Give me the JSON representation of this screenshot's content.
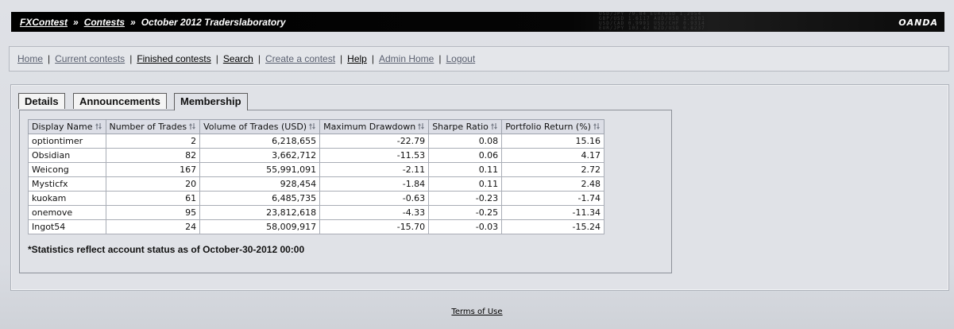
{
  "header": {
    "crumbs": [
      "FXContest",
      "Contests"
    ],
    "separator": "»",
    "current": "October 2012 Traderslaboratory",
    "brand": "OANDA",
    "ticker_text": "USD/JPY 79.84 EUR/USD 1.2954\nGBP/USD 1.6117 AUD/USD 1.0381\nUSD/CAD 0.9991 USD/CHF 0.9314\nEUR/JPY 103.42 NZD/USD 0.8237"
  },
  "nav": {
    "items": [
      {
        "label": "Home",
        "style": "dim"
      },
      {
        "label": "Current contests",
        "style": "dim"
      },
      {
        "label": "Finished contests",
        "style": "dark"
      },
      {
        "label": "Search",
        "style": "dark"
      },
      {
        "label": "Create a contest",
        "style": "dim"
      },
      {
        "label": "Help",
        "style": "dark"
      },
      {
        "label": "Admin Home",
        "style": "dim"
      },
      {
        "label": "Logout",
        "style": "dim"
      }
    ],
    "divider": "|"
  },
  "tabs": [
    {
      "label": "Details",
      "active": false
    },
    {
      "label": "Announcements",
      "active": false
    },
    {
      "label": "Membership",
      "active": true
    }
  ],
  "table": {
    "headers": [
      "Display Name",
      "Number of Trades",
      "Volume of Trades (USD)",
      "Maximum Drawdown",
      "Sharpe Ratio",
      "Portfolio Return (%)"
    ],
    "rows": [
      [
        "optiontimer",
        "2",
        "6,218,655",
        "-22.79",
        "0.08",
        "15.16"
      ],
      [
        "Obsidian",
        "82",
        "3,662,712",
        "-11.53",
        "0.06",
        "4.17"
      ],
      [
        "Weicong",
        "167",
        "55,991,091",
        "-2.11",
        "0.11",
        "2.72"
      ],
      [
        "Mysticfx",
        "20",
        "928,454",
        "-1.84",
        "0.11",
        "2.48"
      ],
      [
        "kuokam",
        "61",
        "6,485,735",
        "-0.63",
        "-0.23",
        "-1.74"
      ],
      [
        "onemove",
        "95",
        "23,812,618",
        "-4.33",
        "-0.25",
        "-11.34"
      ],
      [
        "Ingot54",
        "24",
        "58,009,917",
        "-15.70",
        "-0.03",
        "-15.24"
      ]
    ],
    "sort_icon": "sort-arrows-icon"
  },
  "note": "*Statistics reflect account status as of October-30-2012 00:00",
  "footer": {
    "terms": "Terms of Use"
  },
  "colors": {
    "header_bg": "#000000",
    "nav_dim_link": "#5a6070",
    "panel_bg": "#e0e2e7",
    "table_header_bg": "#dcdee6"
  }
}
